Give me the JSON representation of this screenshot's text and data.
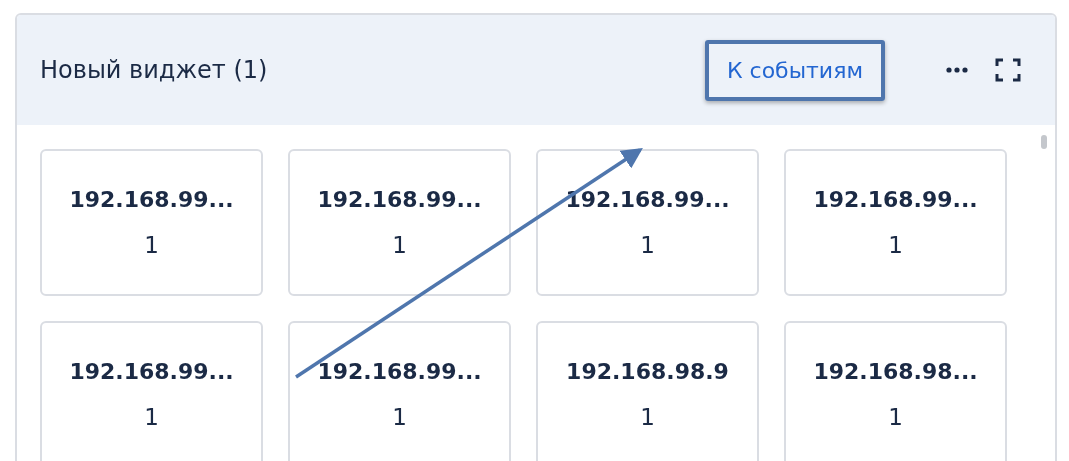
{
  "widget": {
    "title": "Новый виджет (1)",
    "events_link": "К событиям",
    "highlighted": true
  },
  "cards": [
    {
      "label": "192.168.99...",
      "value": "1"
    },
    {
      "label": "192.168.99...",
      "value": "1"
    },
    {
      "label": "192.168.99...",
      "value": "1"
    },
    {
      "label": "192.168.99...",
      "value": "1"
    },
    {
      "label": "192.168.99...",
      "value": "1"
    },
    {
      "label": "192.168.99...",
      "value": "1"
    },
    {
      "label": "192.168.98.9",
      "value": "1"
    },
    {
      "label": "192.168.98...",
      "value": "1"
    }
  ]
}
